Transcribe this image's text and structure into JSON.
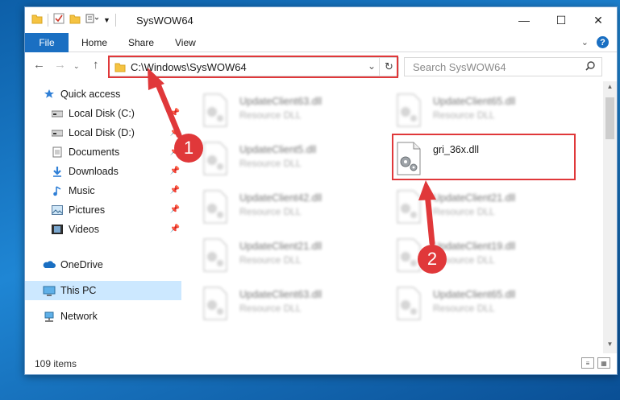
{
  "window": {
    "title": "SysWOW64",
    "buttons": {
      "minimize": "—",
      "maximize": "☐",
      "close": "✕"
    }
  },
  "ribbon": {
    "tabs": [
      "File",
      "Home",
      "Share",
      "View"
    ],
    "expand_icon": "chevron-down",
    "help": "?"
  },
  "address": {
    "path": "C:\\Windows\\SysWOW64",
    "search_placeholder": "Search SysWOW64"
  },
  "sidebar": {
    "items": [
      {
        "label": "Quick access",
        "icon": "star-icon",
        "pinned": false
      },
      {
        "label": "Local Disk (C:)",
        "icon": "drive-icon",
        "pinned": true
      },
      {
        "label": "Local Disk (D:)",
        "icon": "drive-icon",
        "pinned": true
      },
      {
        "label": "Documents",
        "icon": "documents-icon",
        "pinned": true
      },
      {
        "label": "Downloads",
        "icon": "download-icon",
        "pinned": true
      },
      {
        "label": "Music",
        "icon": "music-icon",
        "pinned": true
      },
      {
        "label": "Pictures",
        "icon": "pictures-icon",
        "pinned": true
      },
      {
        "label": "Videos",
        "icon": "videos-icon",
        "pinned": true
      },
      {
        "label": "OneDrive",
        "icon": "cloud-icon",
        "pinned": false
      },
      {
        "label": "This PC",
        "icon": "computer-icon",
        "pinned": false,
        "selected": true
      },
      {
        "label": "Network",
        "icon": "network-icon",
        "pinned": false
      }
    ]
  },
  "files": [
    {
      "name": "UpdateClient63.dll",
      "type": "Resource DLL"
    },
    {
      "name": "UpdateClient65.dll",
      "type": "Resource DLL"
    },
    {
      "name": "UpdateClient5.dll",
      "type": "Resource DLL"
    },
    {
      "name": "gri_36x.dll",
      "type": ""
    },
    {
      "name": "UpdateClient42.dll",
      "type": "Resource DLL"
    },
    {
      "name": "UpdateClient21.dll",
      "type": "Resource DLL"
    },
    {
      "name": "UpdateClient21.dll",
      "type": "Resource DLL"
    },
    {
      "name": "UpdateClient19.dll",
      "type": "Resource DLL"
    },
    {
      "name": "UpdateClient63.dll",
      "type": "Resource DLL"
    },
    {
      "name": "UpdateClient65.dll",
      "type": "Resource DLL"
    }
  ],
  "status": {
    "item_count": "109 items"
  },
  "annotations": {
    "step1": "1",
    "step2": "2",
    "color": "#e0383a"
  }
}
